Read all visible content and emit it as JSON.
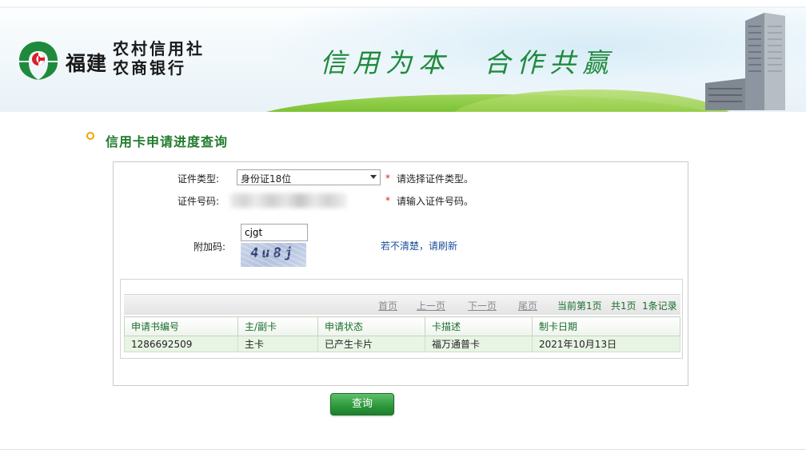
{
  "banner": {
    "brand_main": "福建",
    "brand_line1": "农村信用社",
    "brand_line2": "农商银行",
    "slogan_left": "信用为本",
    "slogan_right": "合作共赢"
  },
  "section": {
    "title": "信用卡申请进度查询"
  },
  "form": {
    "id_type_label": "证件类型:",
    "id_type_value": "身份证18位",
    "id_type_hint": "请选择证件类型。",
    "id_number_label": "证件号码:",
    "id_number_hint": "请输入证件号码。",
    "captcha_label": "附加码:",
    "captcha_input_value": "cjgt",
    "captcha_image_text": "4u8j",
    "refresh_link": "若不清楚，请刷新",
    "required_mark": "*"
  },
  "pager": {
    "first": "首页",
    "prev": "上一页",
    "next": "下一页",
    "last": "尾页",
    "current": "当前第1页",
    "total_pages": "共1页",
    "total_records": "1条记录"
  },
  "table": {
    "headers": [
      "申请书编号",
      "主/副卡",
      "申请状态",
      "卡描述",
      "制卡日期"
    ],
    "rows": [
      [
        "1286692509",
        "主卡",
        "已产生卡片",
        "福万通普卡",
        "2021年10月13日"
      ]
    ]
  },
  "query_button": "查询",
  "colors": {
    "brand_green": "#1f8a3c",
    "title_green": "#1f7a2c",
    "required_red": "#e02020",
    "link_blue": "#1c4e9c"
  }
}
